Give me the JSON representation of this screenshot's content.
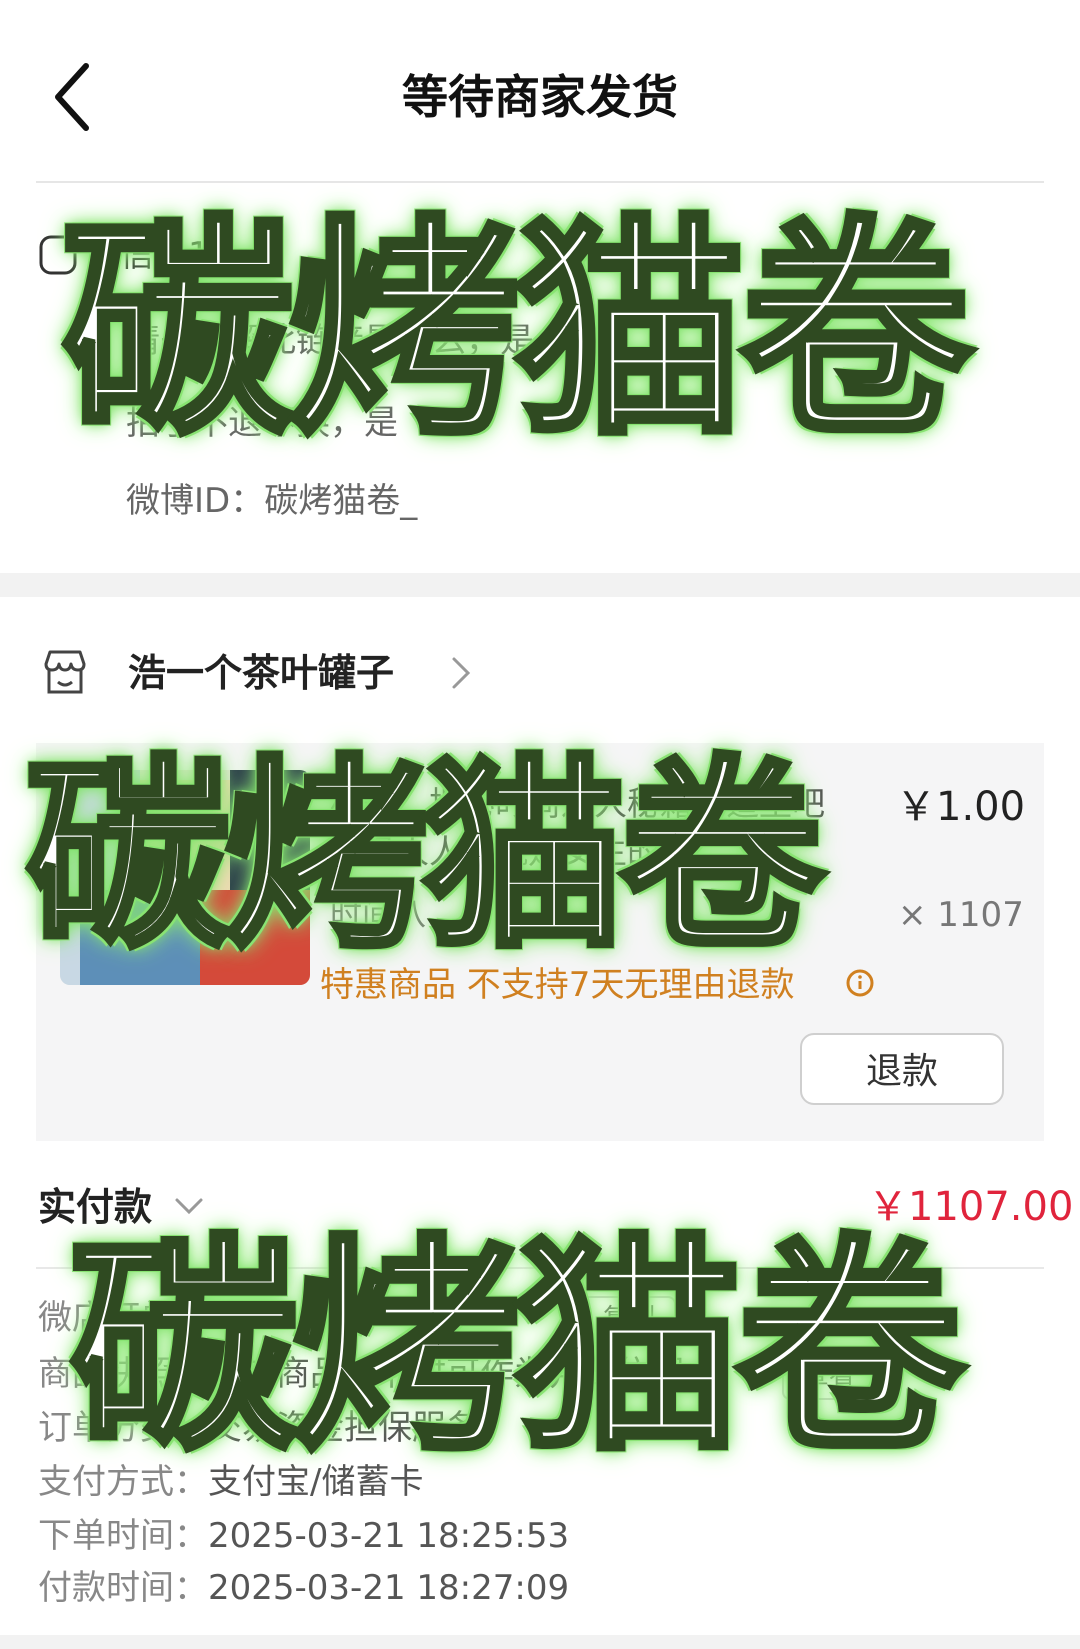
{
  "header": {
    "title": "等待商家发货"
  },
  "message": {
    "title": "信息1",
    "lines": [
      "请先了解此链接是什么，是",
      "拍了不退不换，是",
      "微博ID：碳烤猫卷_"
    ]
  },
  "shop": {
    "name": "浩一个茶叶罐子"
  },
  "product": {
    "title": "标题：揭秘时尚达人秘籍一造型吧自己人人人就是女生的时…",
    "spec": "时间八、",
    "price": "￥1.00",
    "qty": "× 1107",
    "note": "特惠商品 不支持7天无理由退款",
    "refund_label": "退款"
  },
  "totals": {
    "paid_label": "实付款",
    "paid_amount": "￥1107.00"
  },
  "details": {
    "order_no_label": "微店订单号：",
    "order_no_value": "8 2",
    "copy_label": "复制",
    "snapshot_label": "商品快照：",
    "snapshot_value": "核对商品细节时可作为判断依据",
    "view_label": "查看",
    "category_label": "订单分类：",
    "category_value": "交易资金担保服务",
    "pay_method_label": "支付方式：",
    "pay_method_value": "支付宝/储蓄卡",
    "order_time_label": "下单时间：",
    "order_time_value": "2025-03-21 18:25:53",
    "pay_time_label": "付款时间：",
    "pay_time_value": "2025-03-21 18:27:09"
  },
  "watermark": {
    "text": "碳烤猫卷"
  },
  "colors": {
    "price_red": "#e0243c",
    "note_orange": "#d08020",
    "watermark_glow": "#7ee06a"
  }
}
